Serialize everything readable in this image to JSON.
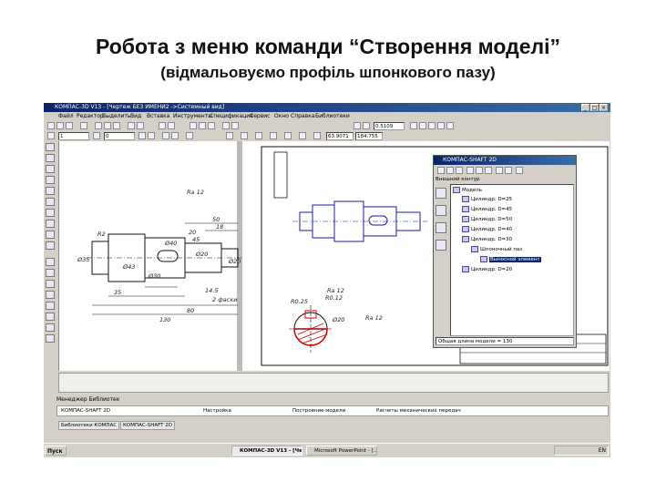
{
  "slide": {
    "title": "Робота з меню команди “Створення моделі”",
    "subtitle": "(відмальовуємо профіль шпонкового пазу)"
  },
  "window": {
    "title": "КОМПАС-3D V13 - [Чертеж БЕЗ ИМЕНИ2 ->Системный вид]",
    "controls": [
      "_",
      "□",
      "×"
    ]
  },
  "menu": [
    "Файл",
    "Редактор",
    "Выделить",
    "Вид",
    "Вставка",
    "Инструменты",
    "Спецификация",
    "Сервис",
    "Окно",
    "Справка",
    "Библиотеки"
  ],
  "toolbar": {
    "zoom_value": "0.5109",
    "style_value": "1",
    "step_value": "0",
    "coord_x": "63.9071",
    "coord_y": "184.755"
  },
  "drawing": {
    "dims": [
      "Ø35",
      "R2",
      "Ø43",
      "Ø30",
      "Ø40",
      "Ø20",
      "Ø20",
      "20",
      "50",
      "18",
      "45",
      "14.5",
      "2 фаски",
      "35",
      "80",
      "130",
      "Ra 12"
    ],
    "section_dims": [
      "R0.25",
      "R0.12",
      "Ra 12",
      "Ø20",
      "Ra 12"
    ]
  },
  "shaft_panel": {
    "title": "КОМПАС-SHAFT 2D",
    "label": "Внешний контур",
    "tree": [
      {
        "text": "Модель"
      },
      {
        "text": "Цилиндр. D=25"
      },
      {
        "text": "Цилиндр. D=45"
      },
      {
        "text": "Цилиндр. D=50"
      },
      {
        "text": "Цилиндр. D=40"
      },
      {
        "text": "Цилиндр. D=30"
      },
      {
        "text": "Шпоночный паз"
      },
      {
        "text": "Выносной элемент"
      },
      {
        "text": "Цилиндр. D=20"
      }
    ],
    "status": "Общая длина модели = 130"
  },
  "library_manager": {
    "title": "Менеджер Библиотек",
    "root": "КОМПАС-SHAFT 2D",
    "items": [
      "Настройка",
      "Построение модели",
      "Расчеты механических передач"
    ],
    "tabs": [
      "Библиотеки КОМПАС",
      "КОМПАС-SHAFT 2D"
    ]
  },
  "taskbar": {
    "start": "Пуск",
    "tasks": [
      "КОМПАС-3D V13 - [Че...",
      "Microsoft PowerPoint - [..."
    ],
    "clock": "EN"
  },
  "colors": {
    "title_bar": "#0a246a",
    "drawing_blue": "#1a1aa8",
    "hatch_red": "#d00000"
  }
}
